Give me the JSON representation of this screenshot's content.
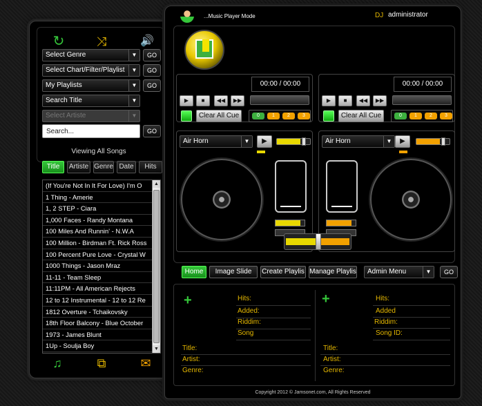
{
  "header": {
    "mode": "...Music Player Mode",
    "dj_label": "DJ",
    "user": "administrator"
  },
  "left_icons": [
    "refresh-icon",
    "shuffle-icon",
    "volume-icon"
  ],
  "filters": {
    "genre": "Select Genre",
    "chart": "Select Chart/Filter/Playlist",
    "playlists": "My Playlists",
    "search_title": "Search Title",
    "artiste": "Select Artiste",
    "search_placeholder": "Search...",
    "go": "GO"
  },
  "viewing": "Viewing All Songs",
  "song_tabs": [
    "Title",
    "Artiste",
    "Genre",
    "Date",
    "Hits"
  ],
  "songs": [
    "(If You're Not In It For Love) I'm O",
    "1 Thing - Amerie",
    "1, 2 STEP - Ciara",
    "1,000 Faces - Randy Montana",
    "100 Miles And Runnin' - N.W.A",
    "100 Million - Birdman Ft. Rick Ross",
    "100 Percent Pure Love - Crystal W",
    "1000 Things - Jason Mraz",
    "11-11 - Team Sleep",
    "11:11PM - All American Rejects",
    "12 to 12 Instrumental - 12 to 12 Re",
    "1812 Overture - Tchaikovsky",
    "18th Floor Balcony - Blue October",
    "1973 - James Blunt",
    "1Up - Soulja Boy"
  ],
  "bottom_icons": [
    "music-note-icon",
    "share-icon",
    "mail-icon"
  ],
  "decks": [
    {
      "time": "00:00 / 00:00",
      "clear_cue": "Clear All Cue",
      "cues": [
        "0",
        "1",
        "2",
        "3"
      ],
      "cue_colors": [
        "#3db03f",
        "#f2a100",
        "#f2a100",
        "#f2a100"
      ],
      "effect": "Air Horn",
      "color": "#e8d800"
    },
    {
      "time": "00:00 / 00:00",
      "clear_cue": "Clear All Cue",
      "cues": [
        "0",
        "1",
        "2",
        "3"
      ],
      "cue_colors": [
        "#3db03f",
        "#f2a100",
        "#f2a100",
        "#f2a100"
      ],
      "effect": "Air Horn",
      "color": "#f2a100"
    }
  ],
  "nav": {
    "home": "Home",
    "image_slide": "Image Slide",
    "create_playlist": "Create Playlis",
    "manage_playlist": "Manage Playlis",
    "admin_menu": "Admin Menu",
    "go": "GO"
  },
  "info_left": {
    "hits": "Hits:",
    "added": "Added:",
    "riddim": "Riddim:",
    "song": "Song",
    "title": "Title:",
    "artist": "Artist:",
    "genre": "Genre:"
  },
  "info_right": {
    "hits": "Hits:",
    "added": "Added",
    "riddim": "Riddim:",
    "song_id": "Song ID:",
    "title": "Title:",
    "artist": "Artist:",
    "genre": "Genre:"
  },
  "copyright": "Copyright 2012 © Jamsonet.com, All Rights Reserved",
  "colors": {
    "accent_green": "#35c63a",
    "accent_yellow": "#e6b800",
    "accent_orange": "#f2a100"
  }
}
